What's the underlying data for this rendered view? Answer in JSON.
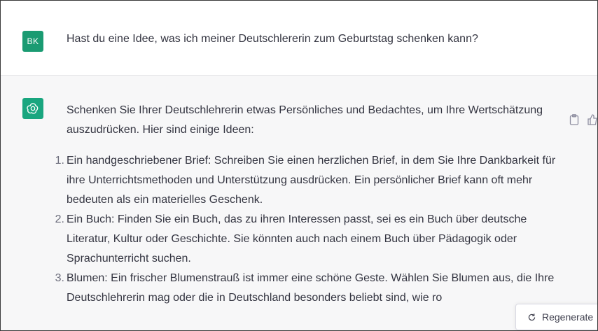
{
  "user_message": {
    "avatar_initials": "BK",
    "text": "Hast du eine Idee, was ich meiner Deutschlererin zum Geburtstag schenken kann?"
  },
  "assistant_message": {
    "avatar_icon": "openai-logo-icon",
    "intro": "Schenken Sie Ihrer Deutschlehrerin etwas Persönliches und Bedachtes, um Ihre Wertschätzung auszudrücken. Hier sind einige Ideen:",
    "items": [
      {
        "number": "1.",
        "text": "Ein handgeschriebener Brief: Schreiben Sie einen herzlichen Brief, in dem Sie Ihre Dankbarkeit für ihre Unterrichtsmethoden und Unterstützung ausdrücken. Ein persönlicher Brief kann oft mehr bedeuten als ein materielles Geschenk."
      },
      {
        "number": "2.",
        "text": "Ein Buch: Finden Sie ein Buch, das zu ihren Interessen passt, sei es ein Buch über deutsche Literatur, Kultur oder Geschichte. Sie könnten auch nach einem Buch über Pädagogik oder Sprachunterricht suchen."
      },
      {
        "number": "3.",
        "text": "Blumen: Ein frischer Blumenstrauß ist immer eine schöne Geste. Wählen Sie Blumen aus, die Ihre Deutschlehrerin mag oder die in Deutschland besonders beliebt sind, wie ro"
      }
    ]
  },
  "actions": {
    "copy_icon": "clipboard-icon",
    "thumbs_icon": "thumbs-up-icon"
  },
  "regenerate": {
    "icon": "refresh-icon",
    "label": "Regenerate"
  },
  "colors": {
    "user_avatar": "#1a9b72",
    "assistant_avatar": "#19a67f",
    "assistant_bg": "#f7f7f8",
    "text": "#343541"
  }
}
